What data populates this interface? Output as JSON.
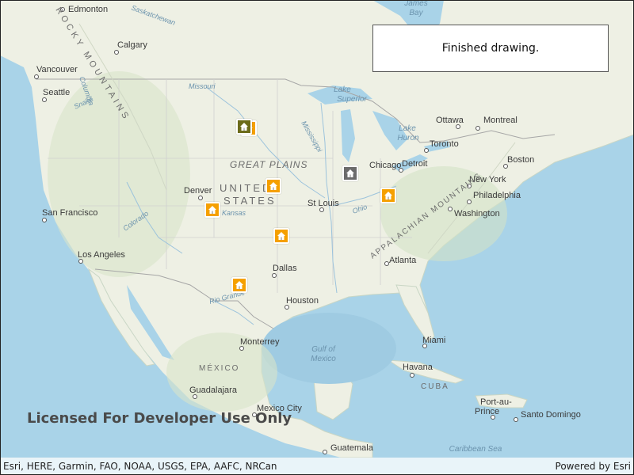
{
  "status": {
    "message": "Finished drawing."
  },
  "license_text": "Licensed For Developer Use Only",
  "attribution": {
    "sources": "Esri, HERE, Garmin, FAO, NOAA, USGS, EPA, AAFC, NRCan",
    "powered_by": "Powered by Esri"
  },
  "colors": {
    "marker_default": "#f5a000",
    "marker_selected": "#6b6b6b",
    "marker_highlight": "#6b6b1a",
    "water": "#a9d3e8",
    "land": "#eef0e4"
  },
  "map_labels": {
    "edmonton": "Edmonton",
    "calgary": "Calgary",
    "vancouver": "Vancouver",
    "seattle": "Seattle",
    "san_francisco": "San Francisco",
    "los_angeles": "Los Angeles",
    "denver": "Denver",
    "dallas": "Dallas",
    "houston": "Houston",
    "monterrey": "Monterrey",
    "guadalajara": "Guadalajara",
    "mexico_city": "Mexico City",
    "guatemala": "Guatemala",
    "st_louis": "St Louis",
    "chicago": "Chicago",
    "detroit": "Detroit",
    "toronto": "Toronto",
    "ottawa": "Ottawa",
    "montreal": "Montreal",
    "boston": "Boston",
    "new_york": "New York",
    "philadelphia": "Philadelphia",
    "washington": "Washington",
    "atlanta": "Atlanta",
    "miami": "Miami",
    "havana": "Havana",
    "port_au_prince_1": "Port-au-",
    "port_au_prince_2": "Prince",
    "santo_domingo": "Santo Domingo",
    "great_plains": "GREAT PLAINS",
    "united": "UNITED",
    "states": "STATES",
    "mexico": "MÉXICO",
    "cuba": "CUBA",
    "rocky_mountains": "ROCKY MOUNTAINS",
    "appalachian": "APPALACHIAN MOUNTAINS",
    "lake_superior_1": "Lake",
    "lake_superior_2": "Superior",
    "lake_huron_1": "Lake",
    "lake_huron_2": "Huron",
    "gulf_1": "Gulf of",
    "gulf_2": "Mexico",
    "caribbean": "Caribbean Sea",
    "james_bay_1": "James",
    "james_bay_2": "Bay",
    "saskatchewan": "Saskatchewan",
    "missouri": "Missouri",
    "mississippi": "Mississippi",
    "kansas": "Kansas",
    "colorado": "Colorado",
    "ohio": "Ohio",
    "rio_grande": "Rio Grande",
    "snake": "Snake",
    "columbia": "Columbia"
  },
  "markers": [
    {
      "name": "marker-north-dakota",
      "state": "default"
    },
    {
      "name": "marker-north-dakota-selected",
      "state": "highlight"
    },
    {
      "name": "marker-nebraska",
      "state": "default"
    },
    {
      "name": "marker-colorado",
      "state": "default"
    },
    {
      "name": "marker-oklahoma",
      "state": "default"
    },
    {
      "name": "marker-texas",
      "state": "default"
    },
    {
      "name": "marker-chicago",
      "state": "selected"
    },
    {
      "name": "marker-ohio",
      "state": "default"
    }
  ]
}
